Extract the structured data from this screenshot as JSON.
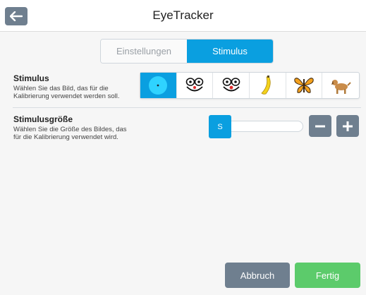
{
  "header": {
    "title": "EyeTracker",
    "back_icon": "arrow-left-icon"
  },
  "tabs": [
    {
      "label": "Einstellungen",
      "active": false
    },
    {
      "label": "Stimulus",
      "active": true
    }
  ],
  "stimulus": {
    "title": "Stimulus",
    "description_line1": "Wählen Sie das Bild, das für die",
    "description_line2": "Kalibrierung verwendet werden soll.",
    "options": [
      {
        "icon": "dot-icon",
        "selected": true
      },
      {
        "icon": "smiley-face-icon",
        "selected": false
      },
      {
        "icon": "smiley-face-red-nose-icon",
        "selected": false
      },
      {
        "icon": "banana-icon",
        "selected": false
      },
      {
        "icon": "butterfly-icon",
        "selected": false
      },
      {
        "icon": "dog-icon",
        "selected": false
      }
    ]
  },
  "size": {
    "title": "Stimulusgröße",
    "description_line1": "Wählen Sie die Größe des Bildes, das",
    "description_line2": "für die Kalibrierung verwendet wird.",
    "value_label": "S"
  },
  "buttons": {
    "cancel": "Abbruch",
    "ok": "Fertig"
  },
  "colors": {
    "accent": "#0a9fe0",
    "gray_button": "#6f7f8f",
    "green_button": "#5ccb6b"
  }
}
